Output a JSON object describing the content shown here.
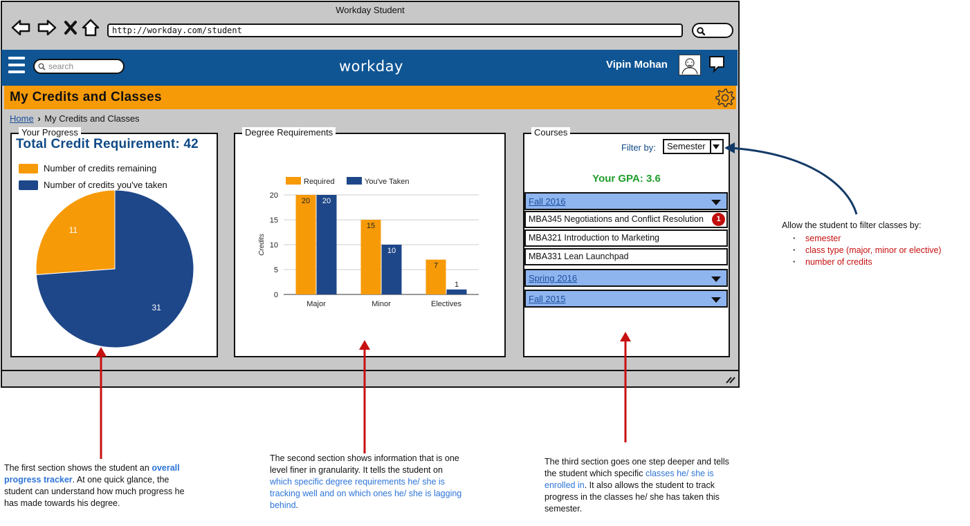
{
  "browser": {
    "title": "Workday Student",
    "url": "http://workday.com/student"
  },
  "header": {
    "search_placeholder": "search",
    "logo": "workday",
    "user_name": "Vipin Mohan"
  },
  "page": {
    "title": "My Credits and Classes",
    "breadcrumb": {
      "home": "Home",
      "current": "My Credits and Classes"
    }
  },
  "progress": {
    "legend": "Your Progress",
    "title": "Total Credit Requirement: 42",
    "legend_remaining": "Number of credits remaining",
    "legend_taken": "Number of credits you've taken",
    "colors": {
      "remaining": "#f79a08",
      "taken": "#1e4789"
    }
  },
  "requirements": {
    "legend": "Degree Requirements"
  },
  "chart_data": [
    {
      "type": "pie",
      "slices": [
        {
          "label": "Number of credits remaining",
          "value": 11,
          "color": "#f79a08"
        },
        {
          "label": "Number of credits you've taken",
          "value": 31,
          "color": "#1e4789"
        }
      ]
    },
    {
      "type": "bar",
      "categories": [
        "Major",
        "Minor",
        "Electives"
      ],
      "series": [
        {
          "name": "Required",
          "values": [
            20,
            15,
            7
          ],
          "color": "#f79a08"
        },
        {
          "name": "You've Taken",
          "values": [
            20,
            10,
            1
          ],
          "color": "#1e4789"
        }
      ],
      "ylabel": "Credits",
      "ylim": [
        0,
        20
      ],
      "yticks": [
        0,
        5,
        10,
        15,
        20
      ],
      "legend_position": "top",
      "grid": true
    }
  ],
  "courses": {
    "legend": "Courses",
    "filter_label": "Filter by:",
    "filter_value": "Semester",
    "gpa": "Your GPA: 3.6",
    "semesters": [
      {
        "label": "Fall 2016"
      },
      {
        "label": "Spring 2016"
      },
      {
        "label": "Fall 2015"
      }
    ],
    "items": [
      {
        "name": "MBA345 Negotiations and Conflict Resolution",
        "badge": "1"
      },
      {
        "name": "MBA321 Introduction to Marketing"
      },
      {
        "name": "MBA331 Lean Launchpad"
      }
    ]
  },
  "annotations": {
    "filter_note": {
      "intro": "Allow the student to filter classes by:",
      "items": [
        "semester",
        "class type (major, minor or elective)",
        "number of credits"
      ]
    },
    "section1": {
      "a": "The first section shows the student an",
      "b": "overall progress tracker",
      "c": ". At one quick glance, the student can understand how much progress he has made towards his degree."
    },
    "section2": {
      "a": "The second section shows information that is one level finer in granularity. It tells the student on",
      "b": "which specific degree requirements he/ she is tracking well and on which ones he/ she is lagging behind",
      "c": "."
    },
    "section3": {
      "a": "The third section goes one step deeper and tells the student which specific",
      "b": "classes he/ she is enrolled in",
      "c": ". It also allows the student to track progress in the classes he/ she has taken this semester."
    }
  }
}
